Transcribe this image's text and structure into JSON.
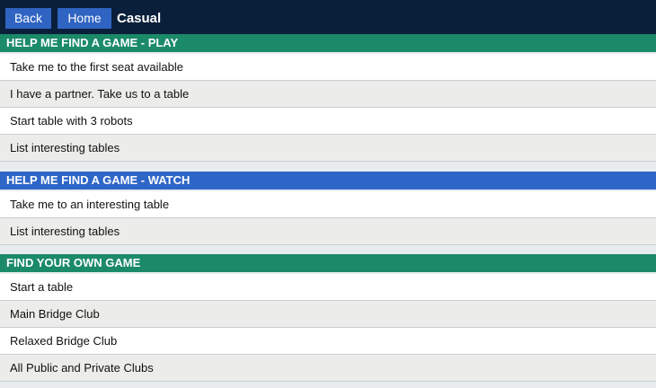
{
  "colors": {
    "topbar": "#0a1f3a",
    "nav_button": "#2f64c2",
    "play_header": "#1b8a68",
    "watch_header": "#2e66c8",
    "find_header": "#1b8a68",
    "row_white": "#ffffff",
    "row_grey": "#ececea"
  },
  "header": {
    "back_label": "Back",
    "home_label": "Home",
    "title": "Casual"
  },
  "sections": {
    "play": {
      "title": "HELP ME FIND A GAME - PLAY",
      "items": [
        "Take me to the first seat available",
        "I have a partner. Take us to a table",
        "Start table with 3 robots",
        "List interesting tables"
      ]
    },
    "watch": {
      "title": "HELP ME FIND A GAME - WATCH",
      "items": [
        "Take me to an interesting table",
        "List interesting tables"
      ]
    },
    "find": {
      "title": "FIND YOUR OWN GAME",
      "items": [
        "Start a table",
        "Main Bridge Club",
        "Relaxed Bridge Club",
        "All Public and Private Clubs"
      ]
    }
  }
}
